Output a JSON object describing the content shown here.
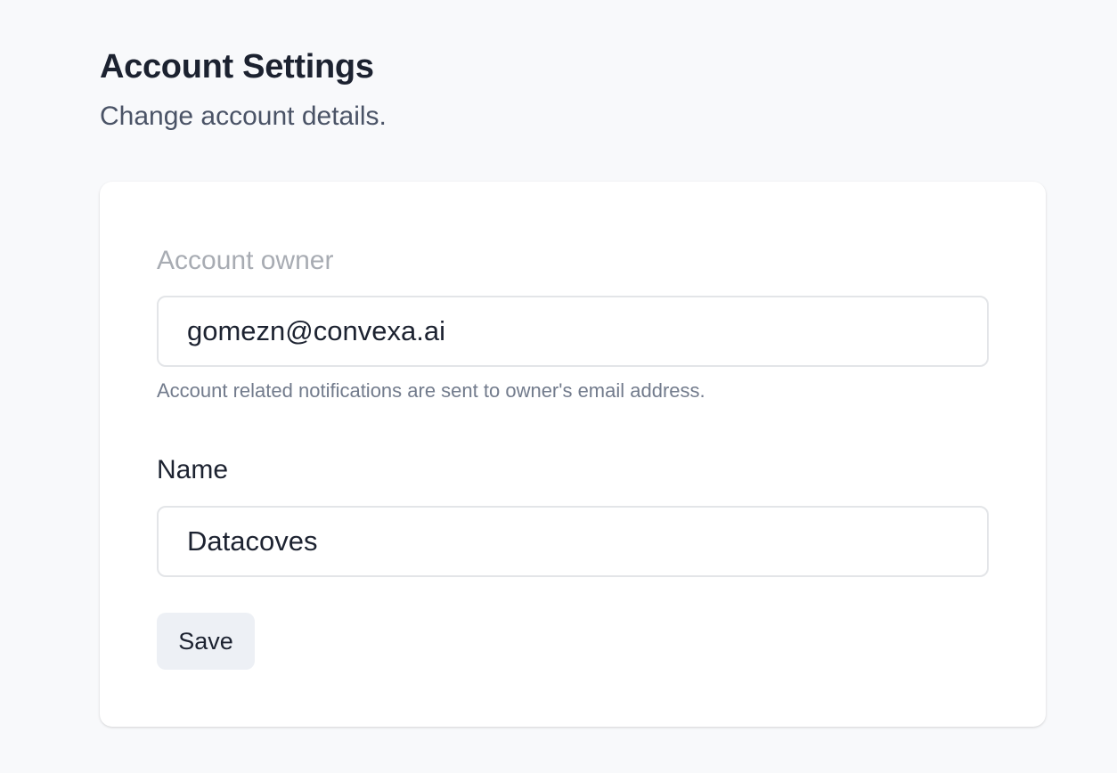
{
  "header": {
    "title": "Account Settings",
    "subtitle": "Change account details."
  },
  "form": {
    "owner": {
      "label": "Account owner",
      "value": "gomezn@convexa.ai",
      "help": "Account related notifications are sent to owner's email address."
    },
    "name": {
      "label": "Name",
      "value": "Datacoves"
    },
    "save_label": "Save"
  }
}
